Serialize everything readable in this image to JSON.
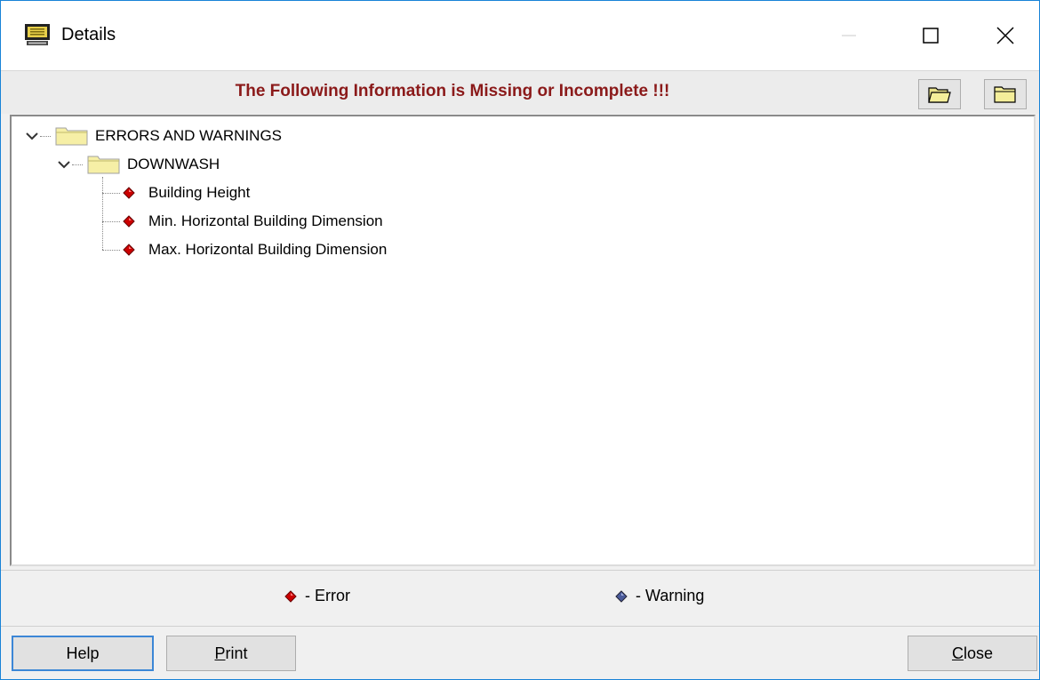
{
  "window": {
    "title": "Details",
    "icon": "monitor-icon",
    "controls": {
      "minimize": "minimize-icon",
      "maximize": "maximize-icon",
      "close": "close-icon"
    }
  },
  "header": {
    "message": "The Following Information is Missing or Incomplete !!!",
    "buttons": [
      {
        "name": "expand-all-button",
        "icon": "open-folder-icon"
      },
      {
        "name": "collapse-all-button",
        "icon": "closed-folder-icon"
      }
    ]
  },
  "tree": {
    "root": {
      "label": "ERRORS AND WARNINGS",
      "expanded": true,
      "children": [
        {
          "label": "DOWNWASH",
          "expanded": true,
          "items": [
            {
              "label": "Building Height",
              "type": "error"
            },
            {
              "label": "Min. Horizontal Building Dimension",
              "type": "error"
            },
            {
              "label": "Max. Horizontal Building Dimension",
              "type": "error"
            }
          ]
        }
      ]
    }
  },
  "legend": {
    "error_label": "- Error",
    "warning_label": "- Warning"
  },
  "buttons": {
    "help": "Help",
    "print_accel": "P",
    "print_rest": "rint",
    "close_accel": "C",
    "close_rest": "lose"
  },
  "colors": {
    "error": "#cc0000",
    "warning": "#4a5a9a",
    "header_text": "#8b1a1a",
    "focus_border": "#3c87d6"
  }
}
